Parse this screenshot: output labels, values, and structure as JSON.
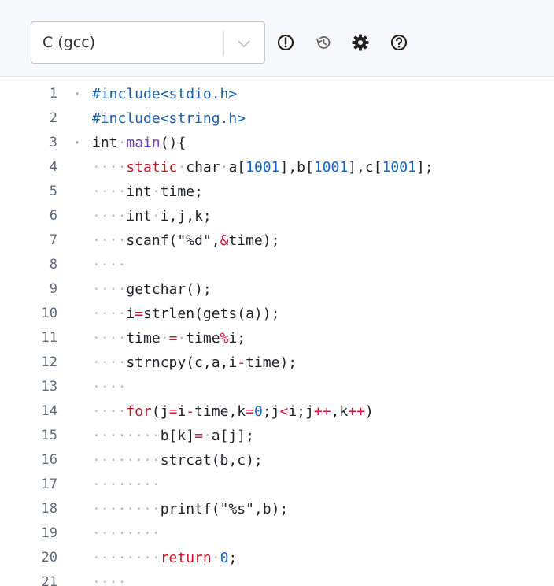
{
  "toolbar": {
    "language": "C (gcc)",
    "icons": [
      "alert-circle-icon",
      "history-icon",
      "gear-icon",
      "help-circle-icon"
    ]
  },
  "colors": {
    "keyword": "#c21a2a",
    "preprocessor": "#1a5fa8",
    "function": "#6a3fb4",
    "number": "#1166c8",
    "operator": "#d0193a",
    "whitespace_marker": "#b8bdc4",
    "line_number": "#5f6b7a"
  },
  "editor": {
    "lines": [
      {
        "n": "1",
        "fold": "▾",
        "tokens": [
          {
            "t": "#include<stdio.h>",
            "c": "pp"
          }
        ]
      },
      {
        "n": "2",
        "fold": "",
        "tokens": [
          {
            "t": "#include<string.h>",
            "c": "pp"
          }
        ]
      },
      {
        "n": "3",
        "fold": "▾",
        "tokens": [
          {
            "t": "int",
            "c": "ty"
          },
          {
            "t": "·",
            "c": "ws"
          },
          {
            "t": "main",
            "c": "fn"
          },
          {
            "t": "(){",
            "c": ""
          }
        ]
      },
      {
        "n": "4",
        "fold": "",
        "tokens": [
          {
            "t": "····",
            "c": "ws"
          },
          {
            "t": "static",
            "c": "kw"
          },
          {
            "t": "·",
            "c": "ws"
          },
          {
            "t": "char",
            "c": "ty"
          },
          {
            "t": "·",
            "c": "ws"
          },
          {
            "t": "a[",
            "c": ""
          },
          {
            "t": "1001",
            "c": "num"
          },
          {
            "t": "],b[",
            "c": ""
          },
          {
            "t": "1001",
            "c": "num"
          },
          {
            "t": "],c[",
            "c": ""
          },
          {
            "t": "1001",
            "c": "num"
          },
          {
            "t": "];",
            "c": ""
          }
        ]
      },
      {
        "n": "5",
        "fold": "",
        "tokens": [
          {
            "t": "····",
            "c": "ws"
          },
          {
            "t": "int",
            "c": "ty"
          },
          {
            "t": "·",
            "c": "ws"
          },
          {
            "t": "time;",
            "c": ""
          }
        ]
      },
      {
        "n": "6",
        "fold": "",
        "tokens": [
          {
            "t": "····",
            "c": "ws"
          },
          {
            "t": "int",
            "c": "ty"
          },
          {
            "t": "·",
            "c": "ws"
          },
          {
            "t": "i,j,k;",
            "c": ""
          }
        ]
      },
      {
        "n": "7",
        "fold": "",
        "tokens": [
          {
            "t": "····",
            "c": "ws"
          },
          {
            "t": "scanf(\"%d\",",
            "c": ""
          },
          {
            "t": "&",
            "c": "op"
          },
          {
            "t": "time);",
            "c": ""
          }
        ]
      },
      {
        "n": "8",
        "fold": "",
        "tokens": [
          {
            "t": "····",
            "c": "ws"
          }
        ]
      },
      {
        "n": "9",
        "fold": "",
        "tokens": [
          {
            "t": "····",
            "c": "ws"
          },
          {
            "t": "getchar();",
            "c": ""
          }
        ]
      },
      {
        "n": "10",
        "fold": "",
        "tokens": [
          {
            "t": "····",
            "c": "ws"
          },
          {
            "t": "i",
            "c": ""
          },
          {
            "t": "=",
            "c": "op"
          },
          {
            "t": "strlen(gets(a));",
            "c": ""
          }
        ]
      },
      {
        "n": "11",
        "fold": "",
        "tokens": [
          {
            "t": "····",
            "c": "ws"
          },
          {
            "t": "time",
            "c": ""
          },
          {
            "t": "·",
            "c": "ws"
          },
          {
            "t": "=",
            "c": "op"
          },
          {
            "t": "·",
            "c": "ws"
          },
          {
            "t": "time",
            "c": ""
          },
          {
            "t": "%",
            "c": "op"
          },
          {
            "t": "i;",
            "c": ""
          }
        ]
      },
      {
        "n": "12",
        "fold": "",
        "tokens": [
          {
            "t": "····",
            "c": "ws"
          },
          {
            "t": "strncpy(c,a,i",
            "c": ""
          },
          {
            "t": "-",
            "c": "op"
          },
          {
            "t": "time);",
            "c": ""
          }
        ]
      },
      {
        "n": "13",
        "fold": "",
        "tokens": [
          {
            "t": "····",
            "c": "ws"
          }
        ]
      },
      {
        "n": "14",
        "fold": "",
        "tokens": [
          {
            "t": "····",
            "c": "ws"
          },
          {
            "t": "for",
            "c": "kw"
          },
          {
            "t": "(j",
            "c": ""
          },
          {
            "t": "=",
            "c": "op"
          },
          {
            "t": "i",
            "c": ""
          },
          {
            "t": "-",
            "c": "op"
          },
          {
            "t": "time,k",
            "c": ""
          },
          {
            "t": "=",
            "c": "op"
          },
          {
            "t": "0",
            "c": "num"
          },
          {
            "t": ";j",
            "c": ""
          },
          {
            "t": "<",
            "c": "op"
          },
          {
            "t": "i;j",
            "c": ""
          },
          {
            "t": "++",
            "c": "op"
          },
          {
            "t": ",k",
            "c": ""
          },
          {
            "t": "++",
            "c": "op"
          },
          {
            "t": ")",
            "c": ""
          }
        ]
      },
      {
        "n": "15",
        "fold": "",
        "tokens": [
          {
            "t": "········",
            "c": "ws"
          },
          {
            "t": "b[k]",
            "c": ""
          },
          {
            "t": "=",
            "c": "op"
          },
          {
            "t": "·",
            "c": "ws"
          },
          {
            "t": "a[j];",
            "c": ""
          }
        ]
      },
      {
        "n": "16",
        "fold": "",
        "tokens": [
          {
            "t": "········",
            "c": "ws"
          },
          {
            "t": "strcat(b,c);",
            "c": ""
          }
        ]
      },
      {
        "n": "17",
        "fold": "",
        "tokens": [
          {
            "t": "········",
            "c": "ws"
          }
        ]
      },
      {
        "n": "18",
        "fold": "",
        "tokens": [
          {
            "t": "········",
            "c": "ws"
          },
          {
            "t": "printf(\"%s\",b);",
            "c": ""
          }
        ]
      },
      {
        "n": "19",
        "fold": "",
        "tokens": [
          {
            "t": "········",
            "c": "ws"
          }
        ]
      },
      {
        "n": "20",
        "fold": "",
        "tokens": [
          {
            "t": "········",
            "c": "ws"
          },
          {
            "t": "return",
            "c": "kw"
          },
          {
            "t": "·",
            "c": "ws"
          },
          {
            "t": "0",
            "c": "num"
          },
          {
            "t": ";",
            "c": ""
          }
        ]
      },
      {
        "n": "21",
        "fold": "",
        "tokens": [
          {
            "t": "····",
            "c": "ws"
          }
        ]
      }
    ]
  }
}
